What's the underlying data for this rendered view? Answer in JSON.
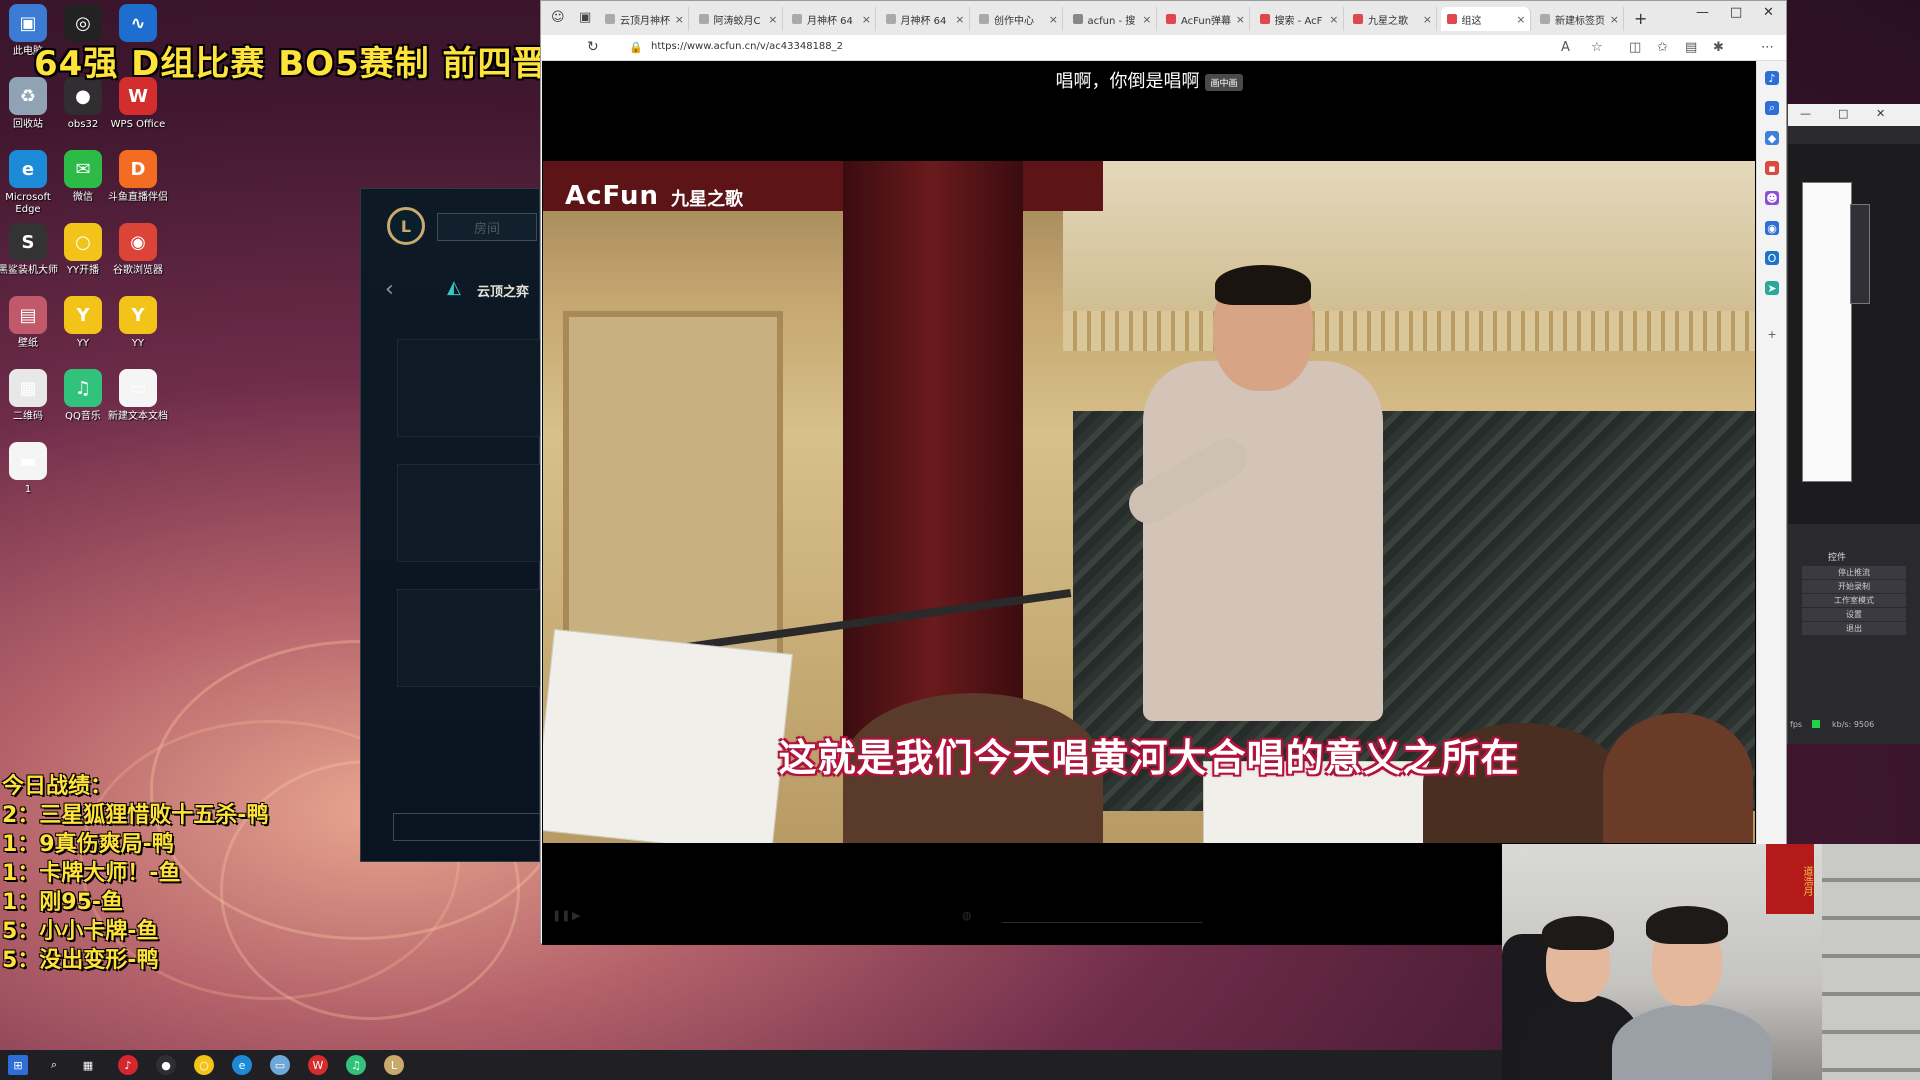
{
  "overlay": {
    "title": "64强 D组比赛 BO5赛制 前四晋级",
    "stats_title": "今日战绩：",
    "stats": [
      "2：三星狐狸惜败十五杀-鸭",
      "1：9真伤爽局-鸭",
      "1：卡牌大师！-鱼",
      "1：刚95-鱼",
      "5：小小卡牌-鱼",
      "5：没出变形-鸭"
    ]
  },
  "desktop": {
    "icons": [
      {
        "label": "此电脑",
        "icon": "computer-icon",
        "glyph": "▣",
        "color": "#3b7bd4"
      },
      {
        "label": "",
        "icon": "app-icon",
        "glyph": "◎",
        "color": "#222"
      },
      {
        "label": "",
        "icon": "monitor-icon",
        "glyph": "∿",
        "color": "#1e6ed0"
      },
      {
        "label": "回收站",
        "icon": "recycle-bin-icon",
        "glyph": "♻",
        "color": "#8fa3b5"
      },
      {
        "label": "obs32",
        "icon": "obs-icon",
        "glyph": "●",
        "color": "#302e31"
      },
      {
        "label": "WPS Office",
        "icon": "wps-icon",
        "glyph": "W",
        "color": "#d32d2d"
      },
      {
        "label": "Microsoft Edge",
        "icon": "edge-icon",
        "glyph": "e",
        "color": "#1c8ad6"
      },
      {
        "label": "微信",
        "icon": "wechat-icon",
        "glyph": "✉",
        "color": "#2dbb47"
      },
      {
        "label": "斗鱼直播伴侣",
        "icon": "douyu-icon",
        "glyph": "D",
        "color": "#f36c21"
      },
      {
        "label": "黑鲨装机大师",
        "icon": "shark-icon",
        "glyph": "S",
        "color": "#333"
      },
      {
        "label": "YY开播",
        "icon": "yy-live-icon",
        "glyph": "○",
        "color": "#f2c318"
      },
      {
        "label": "谷歌浏览器",
        "icon": "chrome-icon",
        "glyph": "◉",
        "color": "#db4437"
      },
      {
        "label": "壁纸",
        "icon": "wallpaper-icon",
        "glyph": "▤",
        "color": "#c05a6a"
      },
      {
        "label": "YY",
        "icon": "yy-icon",
        "glyph": "Y",
        "color": "#f2c318"
      },
      {
        "label": "YY",
        "icon": "yy-icon",
        "glyph": "Y",
        "color": "#f2c318"
      },
      {
        "label": "二维码",
        "icon": "qr-icon",
        "glyph": "▦",
        "color": "#e8e8e8"
      },
      {
        "label": "QQ音乐",
        "icon": "qq-music-icon",
        "glyph": "♫",
        "color": "#31c27c"
      },
      {
        "label": "新建文本文档",
        "icon": "text-file-icon",
        "glyph": "▭",
        "color": "#f5f5f5"
      },
      {
        "label": "1",
        "icon": "file-icon",
        "glyph": "▬",
        "color": "#f5f5f5"
      }
    ]
  },
  "lol_client": {
    "room_label": "房间",
    "mode_label": "云顶之弈"
  },
  "browser": {
    "tabs": [
      {
        "label": "云顶月神杯",
        "fav": "#aaa"
      },
      {
        "label": "阿涛蛟月C",
        "fav": "#aaa"
      },
      {
        "label": "月神杯 64",
        "fav": "#aaa"
      },
      {
        "label": "月神杯 64",
        "fav": "#aaa"
      },
      {
        "label": "创作中心",
        "fav": "#aaa"
      },
      {
        "label": "acfun - 搜",
        "fav": "#888"
      },
      {
        "label": "AcFun弹幕",
        "fav": "#e0474c"
      },
      {
        "label": "搜索 - AcF",
        "fav": "#e0474c"
      },
      {
        "label": "九星之歌",
        "fav": "#e0474c"
      },
      {
        "label": "组这",
        "fav": "#e0474c"
      },
      {
        "label": "新建标签页",
        "fav": "#aaa"
      }
    ],
    "url": "https://www.acfun.cn/v/ac43348188_2",
    "window_controls": [
      "—",
      "□",
      "✕"
    ]
  },
  "video": {
    "danmaku_top": "唱啊，你倒是唱啊",
    "pip_label": "画中画",
    "watermark_logo": "AcFun",
    "watermark_title": "九星之歌",
    "subtitle": "这就是我们今天唱黄河大合唱的意义之所在"
  },
  "obs": {
    "controls_title": "控件",
    "buttons": [
      "停止推流",
      "开始录制",
      "工作室模式",
      "设置",
      "退出"
    ],
    "status_fps": "fps",
    "status_kbs": "kb/s: 9506"
  },
  "webcam": {
    "banner_text": "道浩月"
  }
}
